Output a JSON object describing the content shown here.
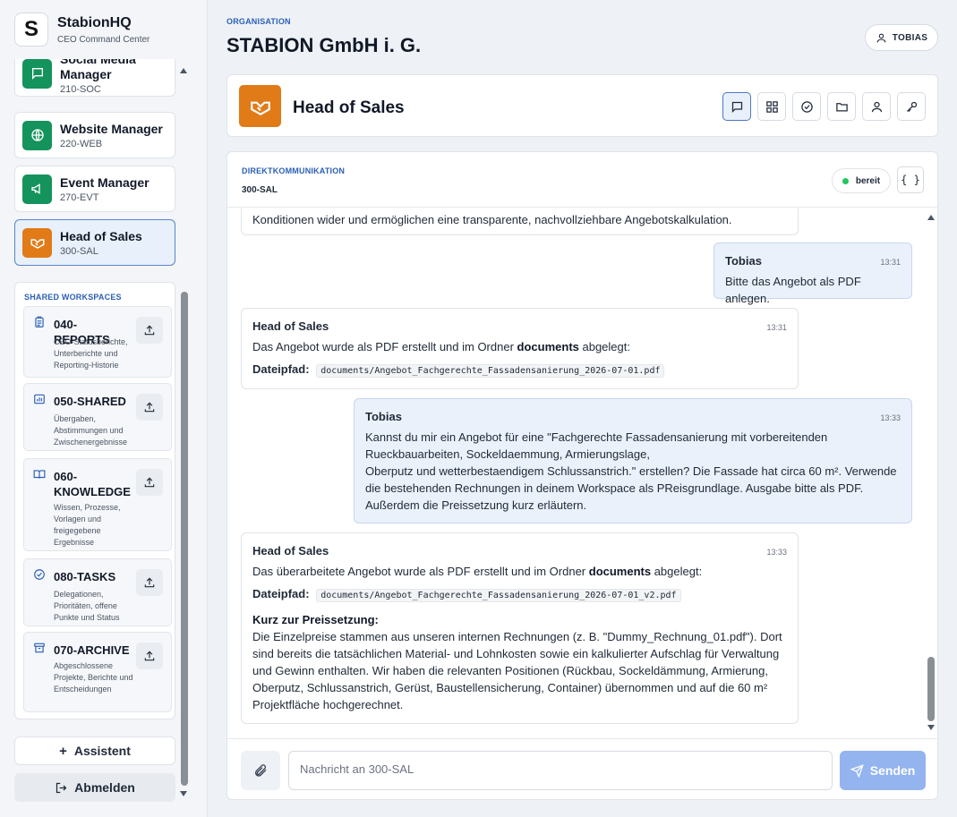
{
  "brand": {
    "logo": "S",
    "name": "StabionHQ",
    "subtitle": "CEO Command Center"
  },
  "agents": [
    {
      "name": "Social Media Manager",
      "code": "210-SOC",
      "icon": "chat-icon",
      "color": "#15935c"
    },
    {
      "name": "Website Manager",
      "code": "220-WEB",
      "icon": "globe-icon",
      "color": "#15935c"
    },
    {
      "name": "Event Manager",
      "code": "270-EVT",
      "icon": "megaphone-icon",
      "color": "#15935c"
    },
    {
      "name": "Head of Sales",
      "code": "300-SAL",
      "icon": "handshake-icon",
      "color": "#e07b18",
      "active": true
    }
  ],
  "workspaces": {
    "title": "SHARED WORKSPACES",
    "items": [
      {
        "name": "040-REPORTS",
        "desc": "CEO-Statusberichte, Unterberichte und Reporting-Historie",
        "icon": "clipboard-icon"
      },
      {
        "name": "050-SHARED",
        "desc": "Übergaben, Abstimmungen und Zwischenergebnisse",
        "icon": "shared-chart-icon"
      },
      {
        "name": "060-KNOWLEDGE",
        "desc": "Wissen, Prozesse, Vorlagen und freigegebene Ergebnisse",
        "icon": "book-icon"
      },
      {
        "name": "080-TASKS",
        "desc": "Delegationen, Prioritäten, offene Punkte und Status",
        "icon": "check-circle-icon"
      },
      {
        "name": "070-ARCHIVE",
        "desc": "Abgeschlossene Projekte, Berichte und Entscheidungen",
        "icon": "archive-icon"
      }
    ]
  },
  "sidebar_buttons": {
    "assistant": "Assistent",
    "logout": "Abmelden"
  },
  "header": {
    "org_label": "ORGANISATION",
    "org_name": "STABION GmbH i. G.",
    "user": "TOBIAS"
  },
  "agent_header": {
    "title": "Head of Sales",
    "tools": [
      "chat-icon",
      "grid-icon",
      "check-circle-icon",
      "folder-icon",
      "user-icon",
      "key-icon"
    ]
  },
  "chat": {
    "label": "DIREKTKOMMUNIKATION",
    "code": "300-SAL",
    "status": "bereit",
    "json_button": "{ }",
    "messages": {
      "m0": {
        "text": "Konditionen wider und ermöglichen eine transparente, nachvollziehbare Angebotskalkulation."
      },
      "m1": {
        "author": "Tobias",
        "time": "13:31",
        "text": "Bitte das Angebot als PDF anlegen."
      },
      "m2": {
        "author": "Head of Sales",
        "time": "13:31",
        "text_a": "Das Angebot wurde als PDF erstellt und im Ordner ",
        "text_b": "documents",
        "text_c": " abgelegt:",
        "path_label": "Dateipfad:",
        "path": "documents/Angebot_Fachgerechte_Fassadensanierung_2026-07-01.pdf"
      },
      "m3": {
        "author": "Tobias",
        "time": "13:33",
        "line1": "Kannst du mir ein Angebot für eine \"Fachgerechte Fassadensanierung mit vorbereitenden",
        "line2": "Rueckbauarbeiten, Sockeldaemmung, Armierungslage,",
        "line3": "Oberputz und wetterbestaendigem Schlussanstrich.\" erstellen? Die Fassade hat circa 60 m². Verwende die bestehenden Rechnungen in deinem Workspace als PReisgrundlage. Ausgabe bitte als PDF. Außerdem die Preissetzung kurz erläutern."
      },
      "m4": {
        "author": "Head of Sales",
        "time": "13:33",
        "text_a": "Das überarbeitete Angebot wurde als PDF erstellt und im Ordner ",
        "text_b": "documents",
        "text_c": " abgelegt:",
        "path_label": "Dateipfad:",
        "path": "documents/Angebot_Fachgerechte_Fassadensanierung_2026-07-01_v2.pdf",
        "subhead": "Kurz zur Preissetzung:",
        "explain": "Die Einzelpreise stammen aus unseren internen Rechnungen (z. B. \"Dummy_Rechnung_01.pdf\"). Dort sind bereits die tatsächlichen Material- und Lohnkosten sowie ein kalkulierter Aufschlag für Verwaltung und Gewinn enthalten. Wir haben die relevanten Positionen (Rückbau, Sockeldämmung, Armierung, Oberputz, Schlussanstrich, Gerüst, Baustellensicherung, Container) übernommen und auf die 60 m² Projektfläche hochgerechnet."
      }
    },
    "composer": {
      "placeholder": "Nachricht an 300-SAL",
      "send": "Senden"
    }
  },
  "colors": {
    "accent": "#2b5fb6",
    "green": "#15935c",
    "orange": "#e07b18",
    "user_bubble": "#eaf1fb",
    "send": "#93b4ef",
    "status": "#22c55e"
  }
}
